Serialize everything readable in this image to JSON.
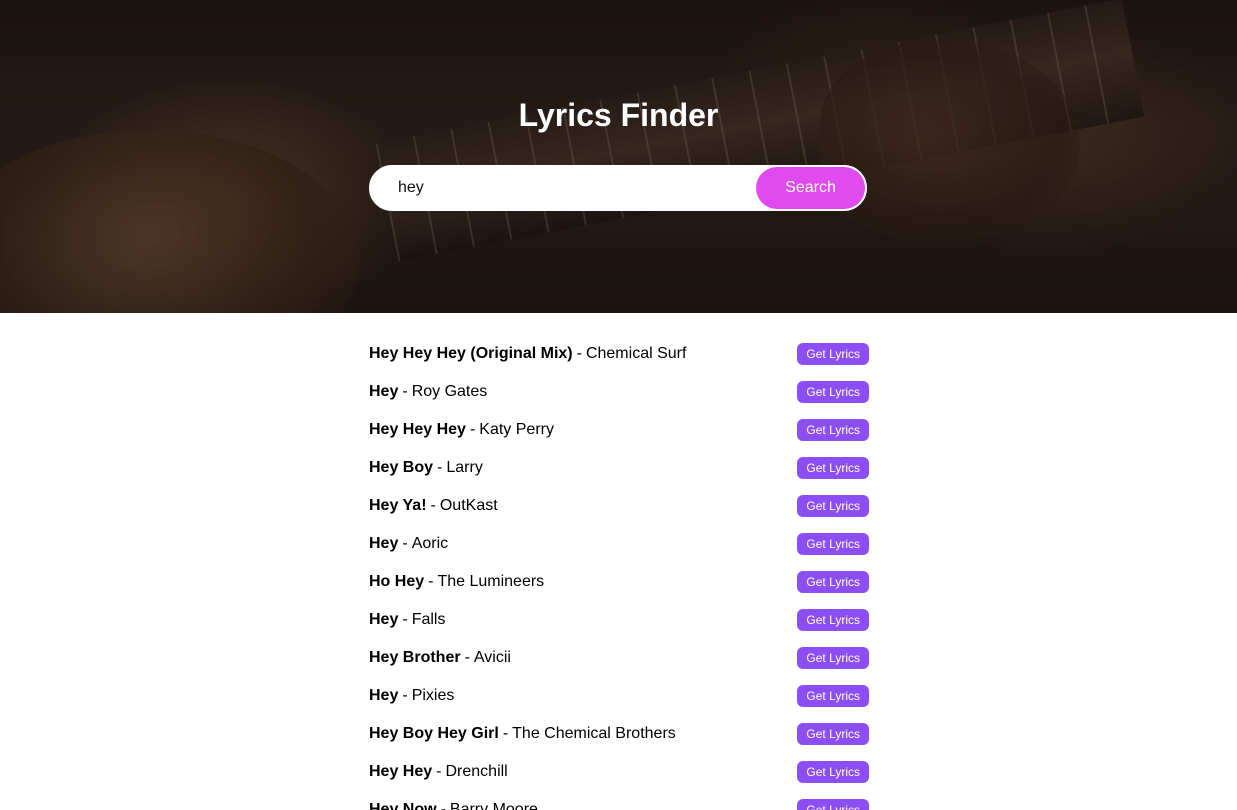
{
  "app": {
    "title": "Lyrics Finder"
  },
  "search": {
    "value": "hey",
    "placeholder": "",
    "button_label": "Search"
  },
  "colors": {
    "search_button": "#e04bf0",
    "get_lyrics_button": "#8c4ef3"
  },
  "results": [
    {
      "title": "Hey Hey Hey (Original Mix)",
      "separator": "-",
      "artist": "Chemical Surf",
      "button_label": "Get Lyrics"
    },
    {
      "title": "Hey",
      "separator": "-",
      "artist": "Roy Gates",
      "button_label": "Get Lyrics"
    },
    {
      "title": "Hey Hey Hey",
      "separator": "-",
      "artist": "Katy Perry",
      "button_label": "Get Lyrics"
    },
    {
      "title": "Hey Boy",
      "separator": "-",
      "artist": "Larry",
      "button_label": "Get Lyrics"
    },
    {
      "title": "Hey Ya!",
      "separator": "-",
      "artist": "OutKast",
      "button_label": "Get Lyrics"
    },
    {
      "title": "Hey",
      "separator": "-",
      "artist": "Aoric",
      "button_label": "Get Lyrics"
    },
    {
      "title": "Ho Hey",
      "separator": "-",
      "artist": "The Lumineers",
      "button_label": "Get Lyrics"
    },
    {
      "title": "Hey",
      "separator": "-",
      "artist": "Falls",
      "button_label": "Get Lyrics"
    },
    {
      "title": "Hey Brother",
      "separator": "-",
      "artist": "Avicii",
      "button_label": "Get Lyrics"
    },
    {
      "title": "Hey",
      "separator": "-",
      "artist": "Pixies",
      "button_label": "Get Lyrics"
    },
    {
      "title": "Hey Boy Hey Girl",
      "separator": "-",
      "artist": "The Chemical Brothers",
      "button_label": "Get Lyrics"
    },
    {
      "title": "Hey Hey",
      "separator": "-",
      "artist": "Drenchill",
      "button_label": "Get Lyrics"
    },
    {
      "title": "Hey Now",
      "separator": "-",
      "artist": "Barry Moore",
      "button_label": "Get Lyrics"
    }
  ]
}
